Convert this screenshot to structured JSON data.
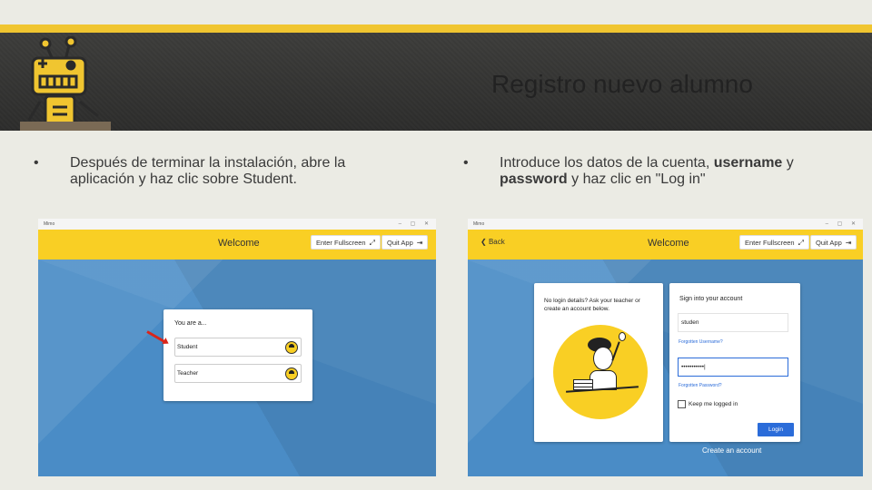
{
  "slide": {
    "title": "Registro nuevo alumno"
  },
  "left": {
    "bullet": "•",
    "text": "Después de terminar la instalación, abre la aplicación y haz clic sobre Student."
  },
  "right": {
    "bullet": "•",
    "text_pre": "Introduce los datos de la cuenta, ",
    "text_b1": "username",
    "text_mid": " y ",
    "text_b2": "password",
    "text_post": " y haz clic en \"Log in\""
  },
  "app_left": {
    "window_title": "Mimo",
    "welcome": "Welcome",
    "fullscreen": "Enter Fullscreen",
    "quit": "Quit App",
    "you_are": "You are a...",
    "student": "Student",
    "teacher": "Teacher"
  },
  "app_right": {
    "window_title": "Mimo",
    "back": "Back",
    "welcome": "Welcome",
    "fullscreen": "Enter Fullscreen",
    "quit": "Quit App",
    "no_login": "No login details? Ask your teacher or create an account below.",
    "sign_in": "Sign into your account",
    "username_value": "studen",
    "forgotten_username": "Forgotten Username?",
    "password_value": "•••••••••••|",
    "forgotten_password": "Forgotten Password?",
    "keep_logged": "Keep me logged in",
    "login": "Login",
    "create_account": "Create an account"
  },
  "colors": {
    "accent": "#f0c530",
    "app_yellow": "#f9cf24",
    "app_blue": "#4a8cc6",
    "link_blue": "#2b6cd9",
    "arrow_red": "#d9251b"
  }
}
